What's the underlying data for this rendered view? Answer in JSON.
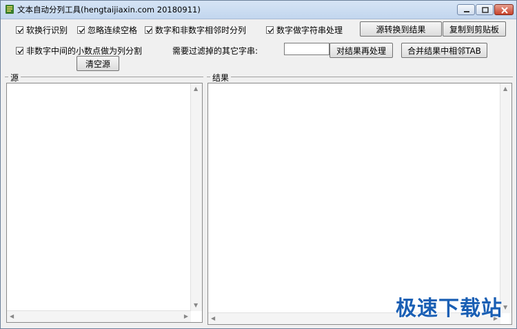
{
  "window": {
    "title": "文本自动分列工具(hengtaijiaxin.com 20180911)"
  },
  "options": {
    "soft_newline": {
      "label": "软换行识别",
      "checked": true
    },
    "ignore_spaces": {
      "label": "忽略连续空格",
      "checked": true
    },
    "split_num_nonnum": {
      "label": "数字和非数字相邻时分列",
      "checked": true
    },
    "num_as_string": {
      "label": "数字做字符串处理",
      "checked": true
    },
    "non_num_dot": {
      "label": "非数字中间的小数点做为列分割",
      "checked": true
    }
  },
  "filter": {
    "label": "需要过滤掉的其它字串:",
    "value": ""
  },
  "buttons": {
    "convert": "源转换到结果",
    "copy": "复制到剪贴板",
    "reprocess": "对结果再处理",
    "merge_tab": "合并结果中相邻TAB",
    "clear_source": "清空源"
  },
  "panels": {
    "source_title": "源",
    "result_title": "结果"
  },
  "watermark": "极速下载站",
  "icons": {
    "app": "app-icon",
    "minimize": "minimize-icon",
    "maximize": "maximize-icon",
    "close": "close-icon",
    "check": "checkmark-icon"
  }
}
